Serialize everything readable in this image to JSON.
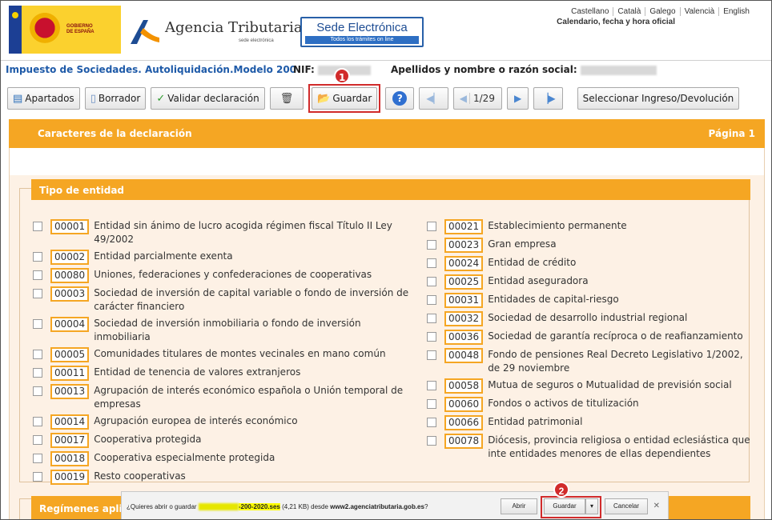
{
  "header": {
    "gov_text": "GOBIERNO DE ESPAÑA",
    "agency_title": "Agencia Tributaria",
    "agency_sub": "sede electrónica",
    "sede_title": "Sede Electrónica",
    "sede_sub": "Todos los trámites on line",
    "languages": [
      "Castellano",
      "Català",
      "Galego",
      "Valencià",
      "English"
    ],
    "calendar_link": "Calendario, fecha y hora oficial"
  },
  "model": {
    "title": "Impuesto de Sociedades. Autoliquidación.Modelo 200",
    "nif_label": "NIF:",
    "apellidos_label": "Apellidos y nombre o razón social:"
  },
  "toolbar": {
    "apartados": "Apartados",
    "borrador": "Borrador",
    "validar": "Validar declaración",
    "guardar": "Guardar",
    "page_indicator": "1/29",
    "seleccionar": "Seleccionar Ingreso/Devolución"
  },
  "annotations": {
    "badge1": "1",
    "badge2": "2"
  },
  "section": {
    "title": "Caracteres de la declaración",
    "page": "Página 1"
  },
  "tipo_entidad": {
    "title": "Tipo de entidad",
    "left": [
      {
        "code": "00001",
        "label": "Entidad sin ánimo de lucro acogida régimen fiscal Título II Ley 49/2002"
      },
      {
        "code": "00002",
        "label": "Entidad parcialmente exenta"
      },
      {
        "code": "00080",
        "label": "Uniones, federaciones y confederaciones de cooperativas"
      },
      {
        "code": "00003",
        "label": "Sociedad de inversión de capital variable o fondo de inversión de carácter financiero"
      },
      {
        "code": "00004",
        "label": "Sociedad de inversión inmobiliaria o fondo de inversión inmobiliaria"
      },
      {
        "code": "00005",
        "label": "Comunidades titulares de montes vecinales en mano común"
      },
      {
        "code": "00011",
        "label": "Entidad de tenencia de valores extranjeros"
      },
      {
        "code": "00013",
        "label": "Agrupación de interés económico española o Unión temporal de empresas"
      },
      {
        "code": "00014",
        "label": "Agrupación europea de interés económico"
      },
      {
        "code": "00017",
        "label": "Cooperativa protegida"
      },
      {
        "code": "00018",
        "label": "Cooperativa especialmente protegida"
      },
      {
        "code": "00019",
        "label": "Resto cooperativas"
      }
    ],
    "right": [
      {
        "code": "00021",
        "label": "Establecimiento permanente"
      },
      {
        "code": "00023",
        "label": "Gran empresa"
      },
      {
        "code": "00024",
        "label": "Entidad de crédito"
      },
      {
        "code": "00025",
        "label": "Entidad aseguradora"
      },
      {
        "code": "00031",
        "label": "Entidades de capital-riesgo"
      },
      {
        "code": "00032",
        "label": "Sociedad de desarrollo industrial regional"
      },
      {
        "code": "00036",
        "label": "Sociedad de garantía recíproca o de reafianzamiento"
      },
      {
        "code": "00048",
        "label": "Fondo de pensiones Real Decreto Legislativo 1/2002, de 29 noviembre"
      },
      {
        "code": "00058",
        "label": "Mutua de seguros o Mutualidad de previsión social"
      },
      {
        "code": "00060",
        "label": "Fondos o activos de titulización"
      },
      {
        "code": "00066",
        "label": "Entidad patrimonial"
      },
      {
        "code": "00078",
        "label": "Diócesis, provincia religiosa o entidad eclesiástica que inte entidades menores de ellas dependientes"
      }
    ]
  },
  "regimenes": {
    "title": "Regímenes aplic"
  },
  "download_bar": {
    "prefix": "¿Quieres abrir o guardar ",
    "filename": "-200-2020.ses",
    "suffix_size": " (4,21 KB) desde ",
    "host": "www2.agenciatributaria.gob.es",
    "suffix_end": "?",
    "abrir": "Abrir",
    "guardar": "Guardar",
    "cancelar": "Cancelar"
  }
}
